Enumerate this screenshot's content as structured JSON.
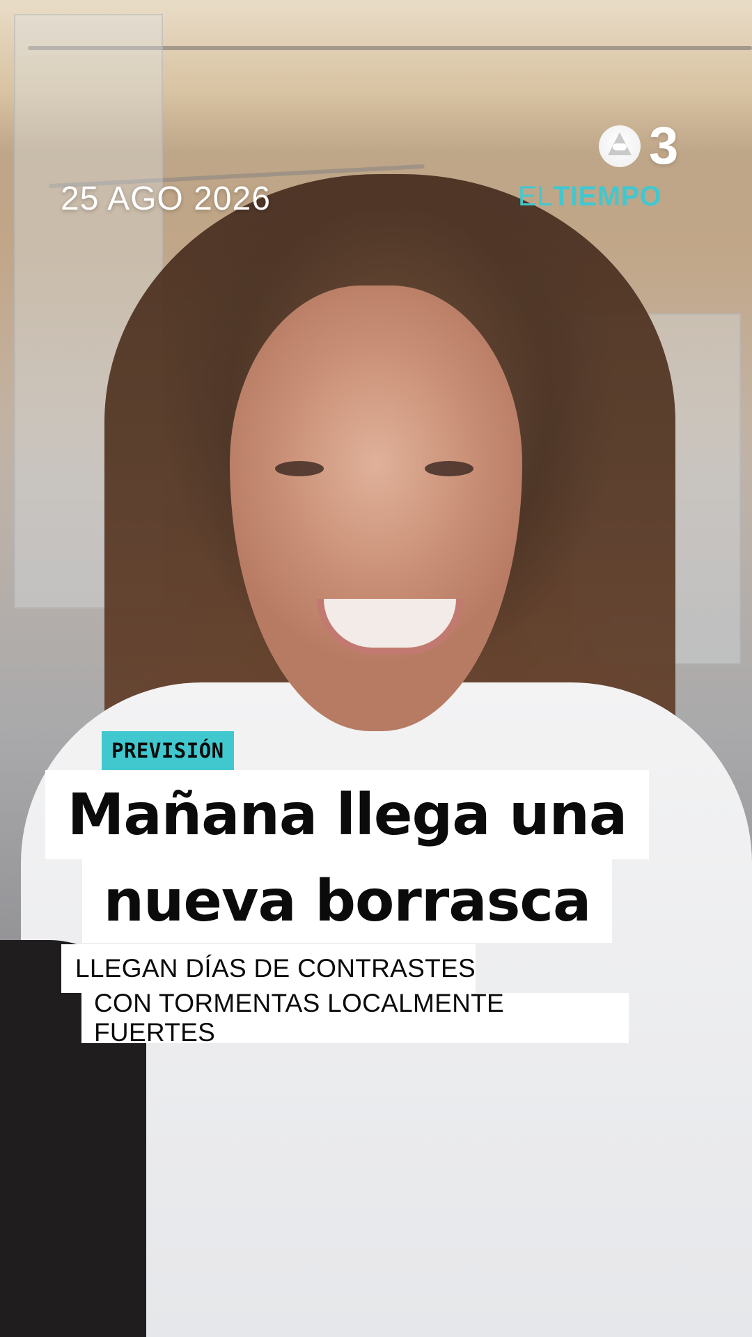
{
  "overlay": {
    "date": "25 AGO 2026",
    "logo": {
      "channel_number": "3",
      "program_prefix": "EL",
      "program_name": "TIEMPO",
      "accent_color": "#41c8cf"
    },
    "category_tag": "PREVISIÓN",
    "headline": {
      "line1": "Mañana llega una",
      "line2": "nueva borrasca"
    },
    "subheadline": {
      "line1": "LLEGAN DÍAS DE CONTRASTES",
      "line2": "CON TORMENTAS LOCALMENTE FUERTES"
    }
  }
}
